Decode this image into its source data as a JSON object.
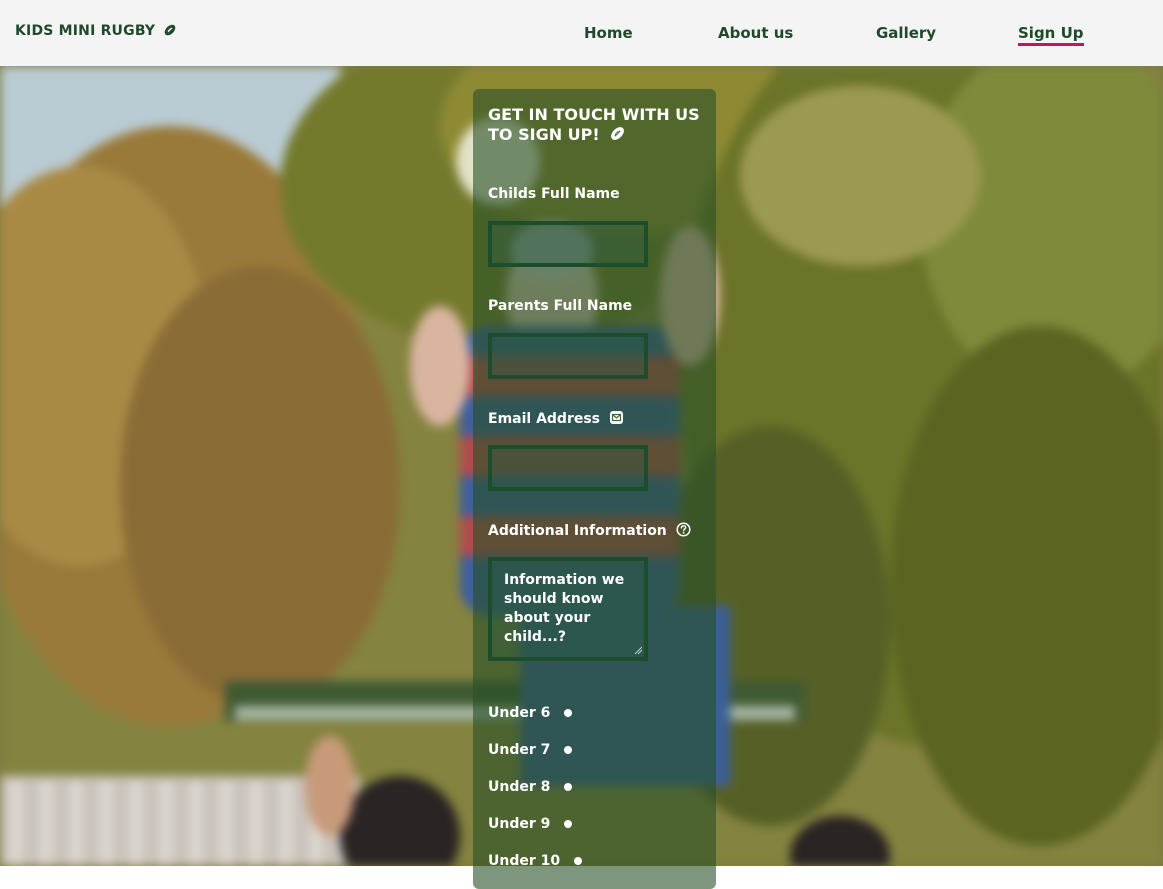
{
  "navbar": {
    "brand": "KIDS MINI RUGBY",
    "brand_icon": "rugby-ball-icon",
    "links": [
      {
        "label": "Home"
      },
      {
        "label": "About us"
      },
      {
        "label": "Gallery"
      },
      {
        "label": "Sign Up",
        "active": true
      }
    ],
    "active_underline_color": "#c2185b",
    "text_color": "#1f4a2a"
  },
  "form": {
    "title": "GET IN TOUCH WITH US TO SIGN UP!",
    "title_icon": "rugby-ball-icon",
    "child_name_label": "Childs Full Name",
    "parent_name_label": "Parents Full Name",
    "email_label": "Email Address",
    "email_icon": "envelope-icon",
    "additional_label": "Additional Information",
    "additional_icon": "question-circle-icon",
    "additional_placeholder": "Information we should know about your child...?",
    "age_groups": [
      "Under 6",
      "Under 7",
      "Under 8",
      "Under 9",
      "Under 10"
    ],
    "panel_color": "#285026",
    "input_border_color": "#1c4d2c"
  }
}
